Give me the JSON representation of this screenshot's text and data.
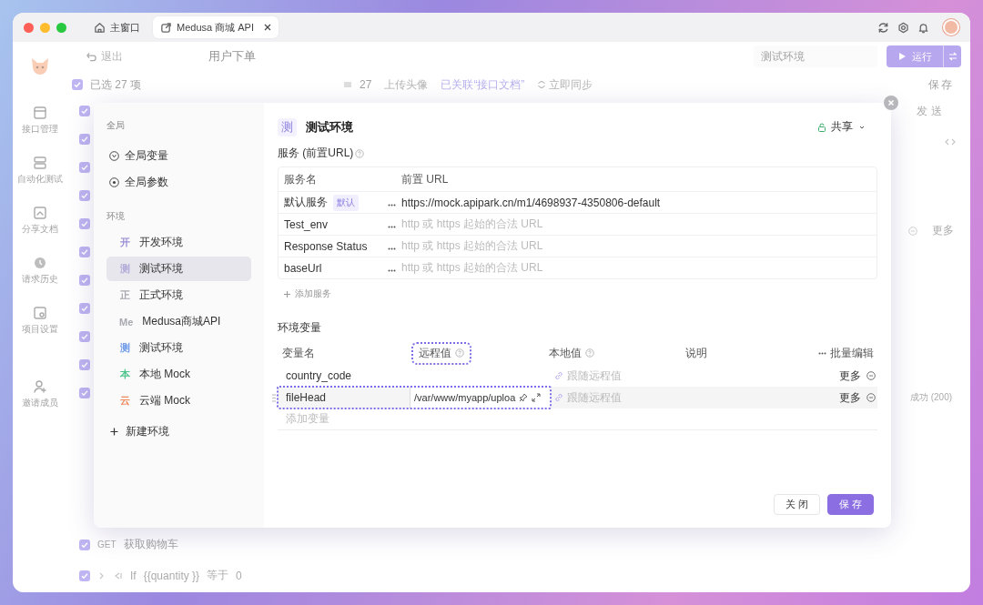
{
  "titlebar": {
    "tabs": [
      {
        "label": "主窗口",
        "selected": false,
        "closable": false
      },
      {
        "label": "Medusa 商城 API",
        "selected": true,
        "closable": true
      }
    ]
  },
  "app_sidebar": {
    "items": [
      {
        "label": "接口管理"
      },
      {
        "label": "自动化测试"
      },
      {
        "label": "分享文档"
      },
      {
        "label": "请求历史"
      },
      {
        "label": "项目设置"
      },
      {
        "label": "邀请成员"
      }
    ]
  },
  "toolbar": {
    "back": "退出",
    "title": "用户下单",
    "environment": "测试环境",
    "run": "运行"
  },
  "selection_bar": {
    "checked": true,
    "selected_count": "已选 27 项",
    "count": "27",
    "upload": "上传头像",
    "linked": "已关联“接口文档”",
    "sync": "立即同步",
    "save": "保存"
  },
  "list_rows": [
    {
      "checked": true
    },
    {
      "checked": true
    },
    {
      "checked": true
    },
    {
      "checked": true
    },
    {
      "checked": true
    },
    {
      "checked": true
    },
    {
      "checked": true
    },
    {
      "checked": true
    },
    {
      "checked": true
    },
    {
      "checked": true
    },
    {
      "checked": true
    }
  ],
  "side_panel": {
    "send": "发送",
    "more": "更多",
    "status": "成功 (200)"
  },
  "bottom_rows": [
    {
      "kind": "request",
      "checked": true,
      "method": "GET",
      "name": "获取购物车"
    },
    {
      "kind": "condition",
      "checked": true,
      "keyword": "If",
      "variable": "{{quantity }}",
      "operator": "等于",
      "value": "0"
    }
  ],
  "dialog": {
    "global_label": "全局",
    "global_items": [
      {
        "label": "全局变量"
      },
      {
        "label": "全局参数"
      }
    ],
    "env_label": "环境",
    "environments": [
      {
        "badge": "开",
        "label": "开发环境",
        "color": "#9d90d8",
        "selected": false
      },
      {
        "badge": "测",
        "label": "测试环境",
        "color": "#b3aad9",
        "selected": true
      },
      {
        "badge": "正",
        "label": "正式环境",
        "color": "#a8a8b0",
        "selected": false
      },
      {
        "badge": "Me",
        "label": "Medusa商城API",
        "color": "#a8a8b0",
        "selected": false
      },
      {
        "badge": "测",
        "label": "测试环境",
        "color": "#6f9be8",
        "selected": false
      },
      {
        "badge": "本",
        "label": "本地 Mock",
        "color": "#4cc38a",
        "selected": false
      },
      {
        "badge": "云",
        "label": "云端 Mock",
        "color": "#f08a5d",
        "selected": false
      }
    ],
    "new_env": "新建环境",
    "header": {
      "badge": "测",
      "title": "测试环境",
      "share": "共享"
    },
    "services": {
      "title": "服务 (前置URL)",
      "columns": [
        "服务名",
        "前置 URL"
      ],
      "rows": [
        {
          "name": "默认服务",
          "tag": "默认",
          "url": "https://mock.apipark.cn/m1/4698937-4350806-default"
        },
        {
          "name": "Test_env",
          "placeholder": "http 或 https 起始的合法 URL"
        },
        {
          "name": "Response Status",
          "placeholder": "http 或 https 起始的合法 URL"
        },
        {
          "name": "baseUrl",
          "placeholder": "http 或 https 起始的合法 URL"
        }
      ],
      "add": "添加服务"
    },
    "variables": {
      "title": "环境变量",
      "columns": [
        {
          "label": "变量名",
          "help": false,
          "highlighted": false
        },
        {
          "label": "远程值",
          "help": true,
          "highlighted": true
        },
        {
          "label": "本地值",
          "help": true,
          "highlighted": false
        },
        {
          "label": "说明",
          "help": false,
          "highlighted": false
        }
      ],
      "bulk_edit": "批量编辑",
      "rows": [
        {
          "name": "country_code",
          "local_placeholder": "跟随远程值",
          "more": "更多",
          "highlighted": false
        },
        {
          "name": "fileHead",
          "remote": "/var/www/myapp/uploa",
          "local_placeholder": "跟随远程值",
          "more": "更多",
          "highlighted": true
        }
      ],
      "add_placeholder": "添加变量"
    },
    "buttons": {
      "close": "关 闭",
      "save": "保 存"
    }
  }
}
